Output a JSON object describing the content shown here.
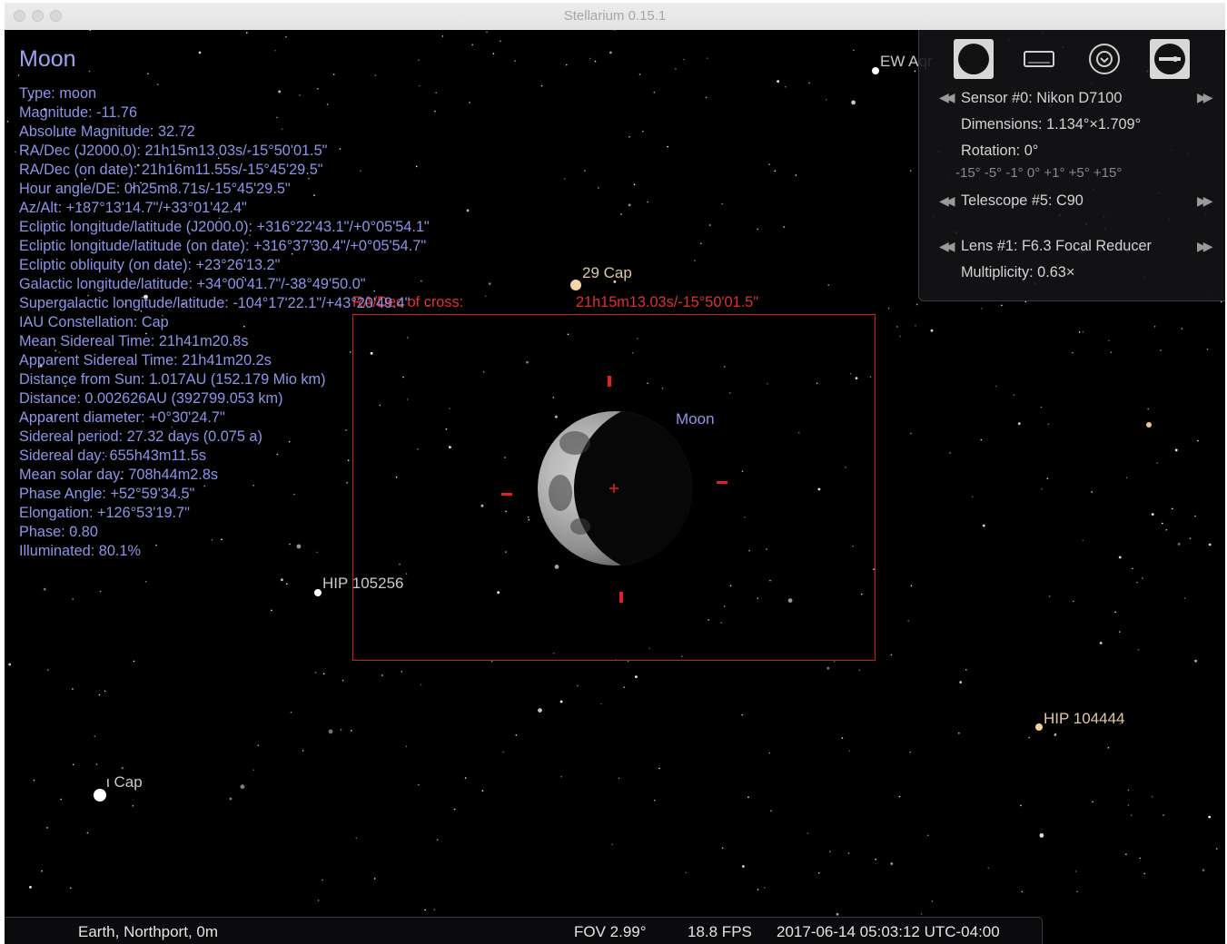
{
  "window": {
    "title": "Stellarium 0.15.1"
  },
  "object_info": {
    "name": "Moon",
    "lines": [
      "Type: moon",
      "Magnitude: -11.76",
      "Absolute Magnitude: 32.72",
      "RA/Dec (J2000.0): 21h15m13.03s/-15°50'01.5\"",
      "RA/Dec (on date): 21h16m11.55s/-15°45'29.5\"",
      "Hour angle/DE: 0h25m8.71s/-15°45'29.5\"",
      "Az/Alt: +187°13'14.7\"/+33°01'42.4\"",
      "Ecliptic longitude/latitude (J2000.0): +316°22'43.1\"/+0°05'54.1\"",
      "Ecliptic longitude/latitude (on date): +316°37'30.4\"/+0°05'54.7\"",
      "Ecliptic obliquity (on date): +23°26'13.2\"",
      "Galactic longitude/latitude: +34°00'41.7\"/-38°49'50.0\"",
      "Supergalactic longitude/latitude: -104°17'22.1\"/+43°20'49.4\"",
      "IAU Constellation: Cap",
      "Mean Sidereal Time: 21h41m20.8s",
      "Apparent Sidereal Time: 21h41m20.2s",
      "Distance from Sun: 1.017AU (152.179 Mio km)",
      "Distance: 0.002626AU (392799.053 km)",
      "Apparent diameter: +0°30'24.7\"",
      "Sidereal period: 27.32 days (0.075 a)",
      "Sidereal day: 655h43m11.5s",
      "Mean solar day: 708h44m2.8s",
      "Phase Angle: +52°59'34.5\"",
      "Elongation: +126°53'19.7\"",
      "Phase: 0.80",
      "Illuminated: 80.1%"
    ]
  },
  "sky_labels": {
    "ew_aqr": "EW Aqr",
    "cap29": "29 Cap",
    "moon": "Moon",
    "hip105256": "HIP 105256",
    "hip104444": "HIP 104444",
    "iota_cap": "ι Cap"
  },
  "ccd": {
    "center_label": "RA/Dec of cross:",
    "center_value": "21h15m13.03s/-15°50'01.5\""
  },
  "oculars": {
    "buttons": [
      "ccd-icon",
      "telrad-icon",
      "ocular-icon",
      "settings-icon"
    ],
    "sensor": "Sensor #0: Nikon D7100",
    "dimensions": "Dimensions: 1.134°×1.709°",
    "rotation": "Rotation: 0°",
    "rotation_steps": "-15°  -5°  -1°  0°  +1°  +5°  +15°",
    "telescope": "Telescope #5: C90",
    "lens": "Lens #1: F6.3 Focal Reducer",
    "multiplicity": "Multiplicity: 0.63×"
  },
  "status_bar": {
    "location": "Earth, Northport, 0m",
    "fov": "FOV 2.99°",
    "fps": "18.8 FPS",
    "datetime": "2017-06-14 05:03:12 UTC-04:00"
  },
  "colors": {
    "info_text": "#8e94e8",
    "ccd_frame": "#d21a1a",
    "sky": "#000000"
  }
}
